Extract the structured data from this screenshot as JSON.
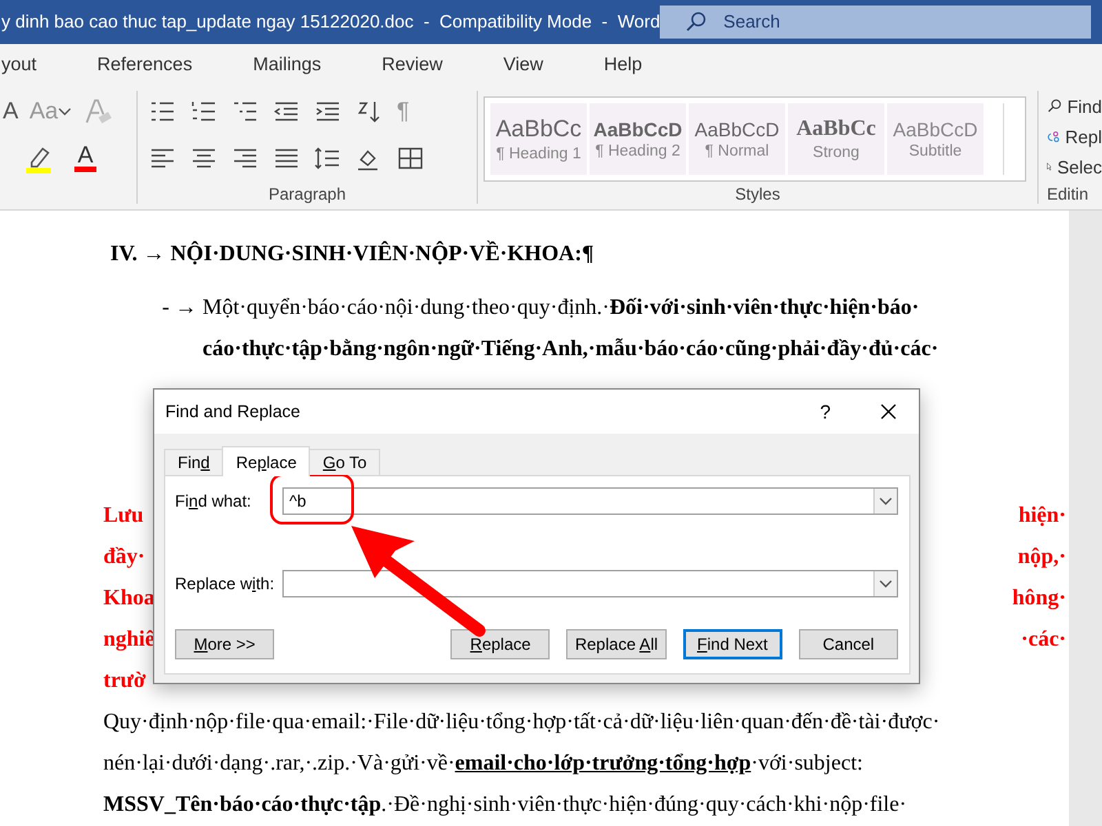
{
  "window": {
    "title": "y dinh bao cao thuc tap_update ngay 15122020.doc  -  Compatibility Mode  -  Word",
    "search": {
      "placeholder": "Search"
    }
  },
  "ribbon_tabs": [
    "yout",
    "References",
    "Mailings",
    "Review",
    "View",
    "Help"
  ],
  "ribbon": {
    "font_tools": [
      {
        "kind": "grow",
        "glyph": "A"
      },
      {
        "kind": "case",
        "glyph": "Aa"
      },
      {
        "kind": "clear"
      },
      {
        "kind": "highlight"
      },
      {
        "kind": "font-color",
        "glyph": "A"
      }
    ],
    "paragraph": {
      "label": "Paragraph",
      "pilcrow": "¶"
    },
    "styles": {
      "label": "Styles",
      "items": [
        {
          "kind": "heading1",
          "sample": "AaBbCc",
          "name": "¶ Heading 1"
        },
        {
          "kind": "heading2",
          "sample": "AaBbCcD",
          "name": "¶ Heading 2"
        },
        {
          "kind": "normal",
          "sample": "AaBbCcD",
          "name": "¶ Normal"
        },
        {
          "kind": "strong",
          "sample": "AaBbCc",
          "name": "Strong"
        },
        {
          "kind": "subtitle",
          "sample": "AaBbCcD",
          "name": "Subtitle"
        }
      ]
    },
    "editing": {
      "label": "Editin",
      "items": [
        {
          "kind": "find",
          "label": "Find"
        },
        {
          "kind": "replace",
          "label": "Repl"
        },
        {
          "kind": "select",
          "label": "Selec"
        }
      ]
    }
  },
  "document": {
    "heading": "IV. → NỘI·DUNG·SINH·VIÊN·NỘP·VỀ·KHOA:¶",
    "bullet": {
      "marker": "- →",
      "lines": [
        "Một·quyển·báo·cáo·nội·dung·theo·quy·định.·**Đối·với·sinh·viên·thực·hiện·báo·**",
        "**cáo·thực·tập·bằng·ngôn·ngữ·Tiếng·Anh,·mẫu·báo·cáo·cũng·phải·đầy·đủ·các·**"
      ]
    },
    "red_lines": [
      {
        "left": "Lưu",
        "right": "hiện·"
      },
      {
        "left": "đầy·",
        "right": "nộp,·"
      },
      {
        "left": "Khoa",
        "right": "hông·"
      },
      {
        "left": "nghiê",
        "right": "·các·"
      },
      {
        "left": "trườ"
      }
    ],
    "body_lines": [
      [
        {
          "text": "Quy·định·nộp·file·qua·email:·File·dữ·liệu·tổng·hợp·tất·cả·dữ·liệu·liên·quan·đến·đề·tài·được·"
        }
      ],
      [
        {
          "text": "nén·lại·dưới·dạng·.rar,·.zip.·Và·gửi·về·"
        },
        {
          "text": "email·cho·lớp·trưởng·tổng·hợp",
          "bold": true,
          "underline": true
        },
        {
          "text": "·với·subject:"
        }
      ],
      [
        {
          "text": "MSSV_Tên·báo·cáo·thực·tập",
          "bold": true
        },
        {
          "text": ".·Đề·nghị·sinh·viên·thực·hiện·đúng·quy·cách·khi·nộp·file·"
        }
      ]
    ]
  },
  "dialog": {
    "title": "Find and Replace",
    "help": "?",
    "tabs": [
      {
        "pre": "Fin",
        "key": "d",
        "selected": false
      },
      {
        "pre": "Re",
        "key": "p",
        "post": "lace",
        "selected": true
      },
      {
        "key": "G",
        "post": "o To",
        "selected": false
      }
    ],
    "fields": [
      {
        "pre": "Fi",
        "key": "n",
        "post": "d what:",
        "value": "^b"
      },
      {
        "pre": "Replace w",
        "key": "i",
        "post": "th:"
      }
    ],
    "buttons": [
      {
        "kind": "more",
        "key": "M",
        "post": "ore >>"
      },
      {
        "kind": "action",
        "key": "R",
        "post": "eplace"
      },
      {
        "kind": "action",
        "pre": "Replace ",
        "key": "A",
        "post": "ll"
      },
      {
        "kind": "default",
        "key": "F",
        "post": "ind Next"
      },
      {
        "kind": "action",
        "pre": "Cancel"
      }
    ]
  }
}
